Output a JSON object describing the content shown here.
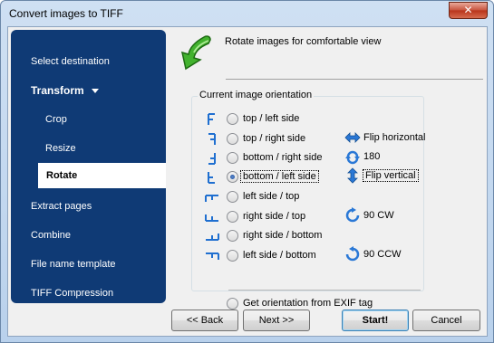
{
  "window": {
    "title": "Convert images to TIFF",
    "close_glyph": "✕"
  },
  "sidebar": {
    "items": [
      {
        "label": "Select destination",
        "indent": false,
        "bold": false,
        "selected": false
      },
      {
        "label": "Transform",
        "indent": false,
        "bold": true,
        "selected": false,
        "expander": true
      },
      {
        "label": "Crop",
        "indent": true,
        "bold": false,
        "selected": false
      },
      {
        "label": "Resize",
        "indent": true,
        "bold": false,
        "selected": false
      },
      {
        "label": "Rotate",
        "indent": true,
        "bold": true,
        "selected": true
      },
      {
        "label": "Extract pages",
        "indent": false,
        "bold": false,
        "selected": false
      },
      {
        "label": "Combine",
        "indent": false,
        "bold": false,
        "selected": false
      },
      {
        "label": "File name template",
        "indent": false,
        "bold": false,
        "selected": false
      },
      {
        "label": "TIFF Compression",
        "indent": false,
        "bold": false,
        "selected": false
      }
    ]
  },
  "header": {
    "text": "Rotate images for comfortable view",
    "icon": "rotate-arrow-icon"
  },
  "orientation_group": {
    "title": "Current image orientation",
    "options": [
      {
        "label": "top / left side",
        "checked": false,
        "glyph": "F-normal"
      },
      {
        "label": "top / right side",
        "checked": false,
        "glyph": "F-mirrored"
      },
      {
        "label": "bottom / right side",
        "checked": false,
        "glyph": "F-rotated-180"
      },
      {
        "label": "bottom / left side",
        "checked": true,
        "glyph": "F-flipped-vertical"
      },
      {
        "label": "left side / top",
        "checked": false,
        "glyph": "F-transposed"
      },
      {
        "label": "right side / top",
        "checked": false,
        "glyph": "F-rotated-90-cw"
      },
      {
        "label": "right side / bottom",
        "checked": false,
        "glyph": "F-transverse"
      },
      {
        "label": "left side / bottom",
        "checked": false,
        "glyph": "F-rotated-90-ccw"
      }
    ],
    "exif_option": {
      "label": "Get orientation from EXIF tag",
      "checked": false
    }
  },
  "actions": {
    "flip_horizontal": {
      "label": "Flip horizontal",
      "icon": "flip-horizontal-icon"
    },
    "rotate_180": {
      "label": "180",
      "icon": "rotate-180-icon"
    },
    "flip_vertical": {
      "label": "Flip vertical",
      "icon": "flip-vertical-icon"
    },
    "rotate_90_cw": {
      "label": "90 CW",
      "icon": "rotate-cw-icon"
    },
    "rotate_90_ccw": {
      "label": "90 CCW",
      "icon": "rotate-ccw-icon"
    }
  },
  "buttons": {
    "back": "<< Back",
    "next": "Next >>",
    "start": "Start!",
    "cancel": "Cancel"
  },
  "colors": {
    "sidebar_bg": "#0f3a75",
    "accent_blue": "#1f6fd0",
    "arrow_green": "#3aa52a"
  }
}
